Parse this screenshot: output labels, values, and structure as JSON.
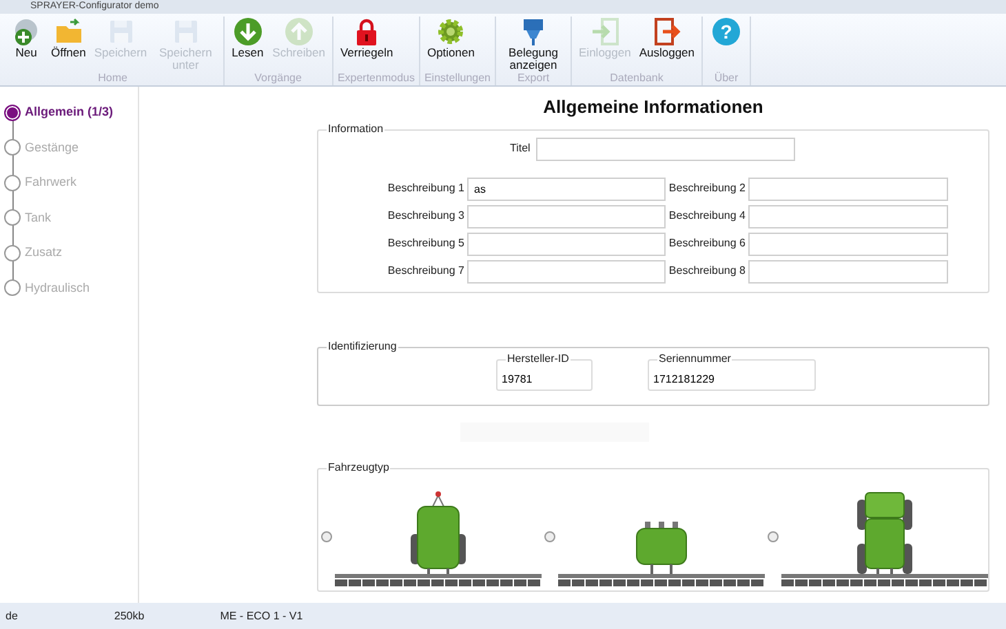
{
  "window": {
    "title": "SPRAYER-Configurator demo"
  },
  "ribbon": {
    "groups": [
      {
        "label": "Home",
        "buttons": [
          {
            "kind": "new",
            "label": "Neu",
            "disabled": false
          },
          {
            "kind": "open",
            "label": "Öffnen",
            "disabled": false
          },
          {
            "kind": "save",
            "label": "Speichern",
            "disabled": true
          },
          {
            "kind": "save",
            "label": "Speichern unter",
            "disabled": true
          }
        ]
      },
      {
        "label": "Vorgänge",
        "buttons": [
          {
            "kind": "read",
            "label": "Lesen",
            "disabled": false
          },
          {
            "kind": "write",
            "label": "Schreiben",
            "disabled": true
          }
        ]
      },
      {
        "label": "Expertenmodus",
        "buttons": [
          {
            "kind": "lock",
            "label": "Verriegeln",
            "disabled": false
          }
        ]
      },
      {
        "label": "Einstellungen",
        "buttons": [
          {
            "kind": "options",
            "label": "Optionen",
            "disabled": false
          }
        ]
      },
      {
        "label": "Export",
        "buttons": [
          {
            "kind": "export",
            "label": "Belegung anzeigen",
            "disabled": false
          }
        ]
      },
      {
        "label": "Datenbank",
        "buttons": [
          {
            "kind": "login",
            "label": "Einloggen",
            "disabled": true
          },
          {
            "kind": "logout",
            "label": "Ausloggen",
            "disabled": false
          }
        ]
      },
      {
        "label": "Über",
        "buttons": [
          {
            "kind": "help",
            "icon_text": "?",
            "disabled": false
          }
        ]
      }
    ]
  },
  "steps": [
    {
      "label": "Allgemein (1/3)",
      "selected": true
    },
    {
      "label": "Gestänge",
      "selected": false
    },
    {
      "label": "Fahrwerk",
      "selected": false
    },
    {
      "label": "Tank",
      "selected": false
    },
    {
      "label": "Zusatz",
      "selected": false
    },
    {
      "label": "Hydraulisch",
      "selected": false
    }
  ],
  "heading": "Allgemeine Informationen",
  "information": {
    "legend": "Information",
    "title_field": {
      "label": "Titel"
    },
    "fields": [
      {
        "label": "Beschreibung 1",
        "value": "as"
      },
      {
        "label": "Beschreibung 2"
      },
      {
        "label": "Beschreibung 3"
      },
      {
        "label": "Beschreibung 4"
      },
      {
        "label": "Beschreibung 5"
      },
      {
        "label": "Beschreibung 6"
      },
      {
        "label": "Beschreibung 7"
      },
      {
        "label": "Beschreibung 8"
      }
    ]
  },
  "identification": {
    "legend": "Identifizierung",
    "fields": [
      {
        "label": "Hersteller-ID",
        "value": "19781"
      },
      {
        "label": "Seriennummer",
        "value": "1712181229"
      }
    ]
  },
  "vehicle_type": {
    "legend": "Fahrzeugtyp",
    "options": [
      {
        "kind": "trailed",
        "selected": false
      },
      {
        "kind": "mounted",
        "selected": false
      },
      {
        "kind": "selfpropelled",
        "selected": false
      }
    ]
  },
  "status_bar": [
    "de",
    "250kb",
    "ME - ECO 1 - V1"
  ]
}
